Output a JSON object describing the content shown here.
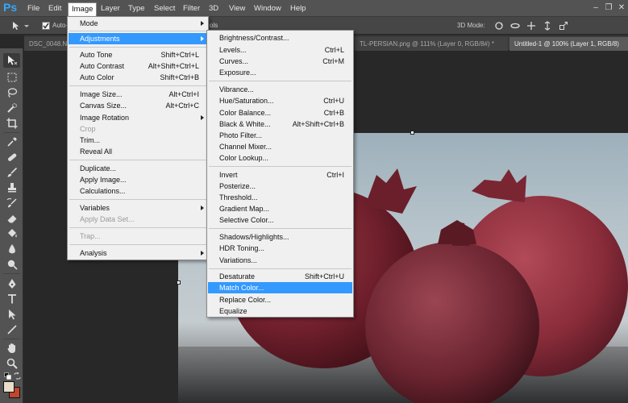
{
  "app": {
    "logo": "Ps"
  },
  "menubar": {
    "items": [
      "File",
      "Edit",
      "Image",
      "Layer",
      "Type",
      "Select",
      "Filter",
      "3D",
      "View",
      "Window",
      "Help"
    ],
    "active": "Image"
  },
  "options": {
    "auto_label": "Auto-",
    "controls_label": "ols",
    "mode3d_label": "3D Mode:"
  },
  "tabs": [
    {
      "label": "DSC_0048.N",
      "active": false
    },
    {
      "label": "TL-PERSIAN.png @ 111% (Layer 0, RGB/8#) *",
      "active": false
    },
    {
      "label": "Untitled-1 @ 100% (Layer 1, RGB/8)",
      "active": true
    }
  ],
  "tools": [
    "move-tool-icon",
    "marquee-tool-icon",
    "lasso-tool-icon",
    "quick-select-tool-icon",
    "crop-tool-icon",
    "eyedropper-tool-icon",
    "healing-brush-icon",
    "brush-tool-icon",
    "clone-stamp-icon",
    "history-brush-icon",
    "eraser-tool-icon",
    "paint-bucket-icon",
    "blur-tool-icon",
    "dodge-tool-icon",
    "pen-tool-icon",
    "type-tool-icon",
    "path-select-icon",
    "line-tool-icon",
    "hand-tool-icon",
    "zoom-tool-icon"
  ],
  "image_menu": {
    "items": [
      {
        "label": "Mode",
        "shortcut": "",
        "submenu": true
      },
      {
        "label": "Adjustments",
        "shortcut": "",
        "submenu": true,
        "highlight": true
      },
      {
        "label": "Auto Tone",
        "shortcut": "Shift+Ctrl+L"
      },
      {
        "label": "Auto Contrast",
        "shortcut": "Alt+Shift+Ctrl+L"
      },
      {
        "label": "Auto Color",
        "shortcut": "Shift+Ctrl+B"
      },
      {
        "label": "Image Size...",
        "shortcut": "Alt+Ctrl+I"
      },
      {
        "label": "Canvas Size...",
        "shortcut": "Alt+Ctrl+C"
      },
      {
        "label": "Image Rotation",
        "shortcut": "",
        "submenu": true
      },
      {
        "label": "Crop",
        "shortcut": "",
        "disabled": true
      },
      {
        "label": "Trim...",
        "shortcut": ""
      },
      {
        "label": "Reveal All",
        "shortcut": ""
      },
      {
        "label": "Duplicate...",
        "shortcut": ""
      },
      {
        "label": "Apply Image...",
        "shortcut": ""
      },
      {
        "label": "Calculations...",
        "shortcut": ""
      },
      {
        "label": "Variables",
        "shortcut": "",
        "submenu": true
      },
      {
        "label": "Apply Data Set...",
        "shortcut": "",
        "disabled": true
      },
      {
        "label": "Trap...",
        "shortcut": "",
        "disabled": true
      },
      {
        "label": "Analysis",
        "shortcut": "",
        "submenu": true
      }
    ]
  },
  "adjustments_menu": {
    "items": [
      {
        "label": "Brightness/Contrast...",
        "shortcut": ""
      },
      {
        "label": "Levels...",
        "shortcut": "Ctrl+L"
      },
      {
        "label": "Curves...",
        "shortcut": "Ctrl+M"
      },
      {
        "label": "Exposure...",
        "shortcut": ""
      },
      {
        "label": "Vibrance...",
        "shortcut": ""
      },
      {
        "label": "Hue/Saturation...",
        "shortcut": "Ctrl+U"
      },
      {
        "label": "Color Balance...",
        "shortcut": "Ctrl+B"
      },
      {
        "label": "Black & White...",
        "shortcut": "Alt+Shift+Ctrl+B"
      },
      {
        "label": "Photo Filter...",
        "shortcut": ""
      },
      {
        "label": "Channel Mixer...",
        "shortcut": ""
      },
      {
        "label": "Color Lookup...",
        "shortcut": ""
      },
      {
        "label": "Invert",
        "shortcut": "Ctrl+I"
      },
      {
        "label": "Posterize...",
        "shortcut": ""
      },
      {
        "label": "Threshold...",
        "shortcut": ""
      },
      {
        "label": "Gradient Map...",
        "shortcut": ""
      },
      {
        "label": "Selective Color...",
        "shortcut": ""
      },
      {
        "label": "Shadows/Highlights...",
        "shortcut": ""
      },
      {
        "label": "HDR Toning...",
        "shortcut": ""
      },
      {
        "label": "Variations...",
        "shortcut": ""
      },
      {
        "label": "Desaturate",
        "shortcut": "Shift+Ctrl+U"
      },
      {
        "label": "Match Color...",
        "shortcut": "",
        "highlight": true
      },
      {
        "label": "Replace Color...",
        "shortcut": ""
      },
      {
        "label": "Equalize",
        "shortcut": ""
      }
    ]
  },
  "colors": {
    "highlight": "#3399ff",
    "foreground_swatch": "#e9dcc8",
    "background_swatch": "#c0452d"
  }
}
